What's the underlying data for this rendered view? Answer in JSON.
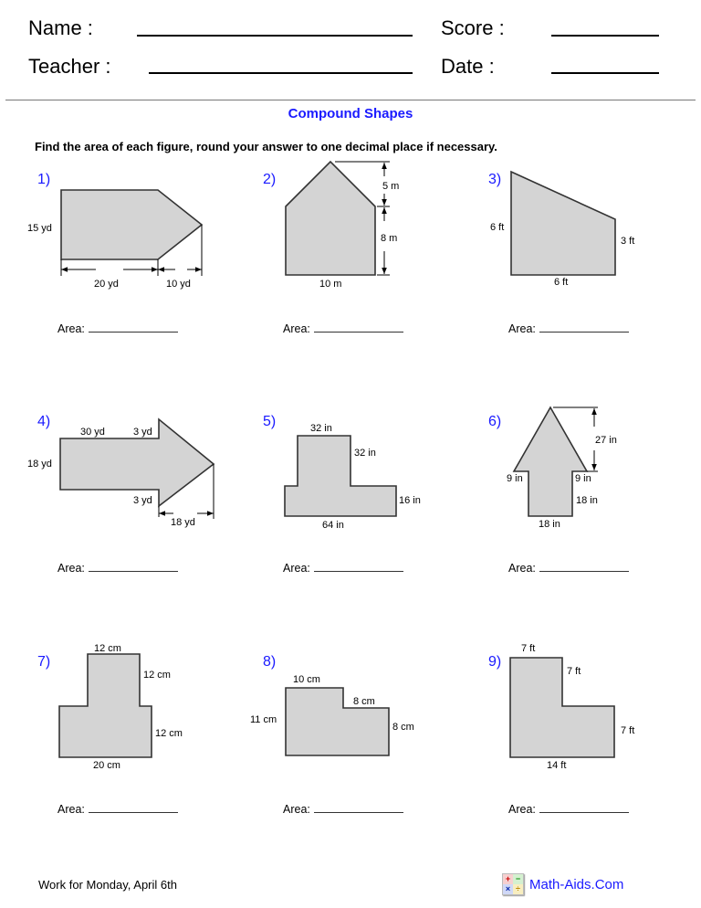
{
  "header": {
    "name_label": "Name :",
    "teacher_label": "Teacher :",
    "score_label": "Score :",
    "date_label": "Date :"
  },
  "worksheet": {
    "title": "Compound Shapes",
    "instructions": "Find the area of each figure, round your answer to one decimal place if necessary.",
    "area_label": "Area:",
    "accent_color": "#1a1aff",
    "shape_fill": "#d4d4d4"
  },
  "problems": [
    {
      "number": "1)",
      "labels": [
        "15 yd",
        "20 yd",
        "10 yd"
      ]
    },
    {
      "number": "2)",
      "labels": [
        "5 m",
        "8 m",
        "10 m"
      ]
    },
    {
      "number": "3)",
      "labels": [
        "6 ft",
        "3 ft",
        "6 ft"
      ]
    },
    {
      "number": "4)",
      "labels": [
        "30 yd",
        "3 yd",
        "18 yd",
        "3 yd",
        "18 yd"
      ]
    },
    {
      "number": "5)",
      "labels": [
        "32 in",
        "32 in",
        "16 in",
        "64 in"
      ]
    },
    {
      "number": "6)",
      "labels": [
        "27 in",
        "9 in",
        "9 in",
        "18 in",
        "18 in"
      ]
    },
    {
      "number": "7)",
      "labels": [
        "12 cm",
        "12 cm",
        "12 cm",
        "20 cm"
      ]
    },
    {
      "number": "8)",
      "labels": [
        "10 cm",
        "8 cm",
        "11 cm",
        "8 cm"
      ]
    },
    {
      "number": "9)",
      "labels": [
        "7 ft",
        "7 ft",
        "7 ft",
        "14 ft"
      ]
    }
  ],
  "footer": {
    "note": "Work for Monday,  April 6th",
    "brand": "Math-Aids.Com",
    "logo_icon": "math-operators-icon",
    "logo_symbols": [
      "+",
      "−",
      "×",
      "÷"
    ]
  }
}
